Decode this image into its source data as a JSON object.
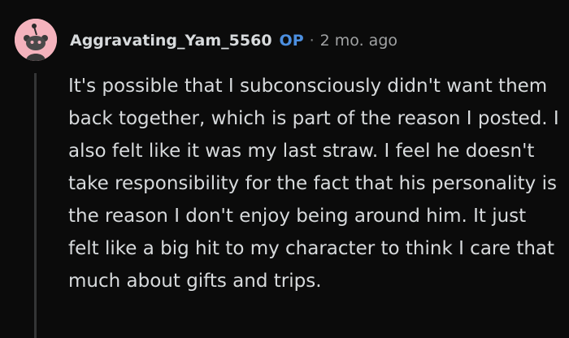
{
  "comment": {
    "author": "Aggravating_Yam_5560",
    "op_badge": "OP",
    "separator": "·",
    "age": "2 mo. ago",
    "avatar_icon": "snoo-avatar-icon",
    "avatar_bg": "#f4b3bd",
    "body": "It's possible that I subconsciously didn't want them back together, which is part of the reason I posted. I also felt like it was my last straw. I feel he doesn't take responsibility for the fact that his personality is the reason I don't enjoy being around him. It just felt like a big hit to my character to think I care that much about gifts and trips."
  },
  "colors": {
    "background": "#0b0b0b",
    "text": "#d7dadc",
    "op_badge": "#4c8fe0",
    "thread_line": "#343536"
  }
}
